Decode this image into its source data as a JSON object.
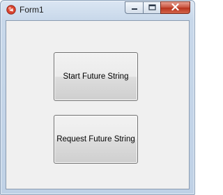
{
  "window": {
    "title": "Form1",
    "controls": {
      "minimize_icon": "minimize-icon",
      "maximize_icon": "maximize-icon",
      "close_icon": "close-icon"
    }
  },
  "buttons": {
    "start_label": "Start Future String",
    "request_label": "Request Future String"
  },
  "colors": {
    "close_button": "#c7503b",
    "client_background": "#f0f0f0"
  }
}
